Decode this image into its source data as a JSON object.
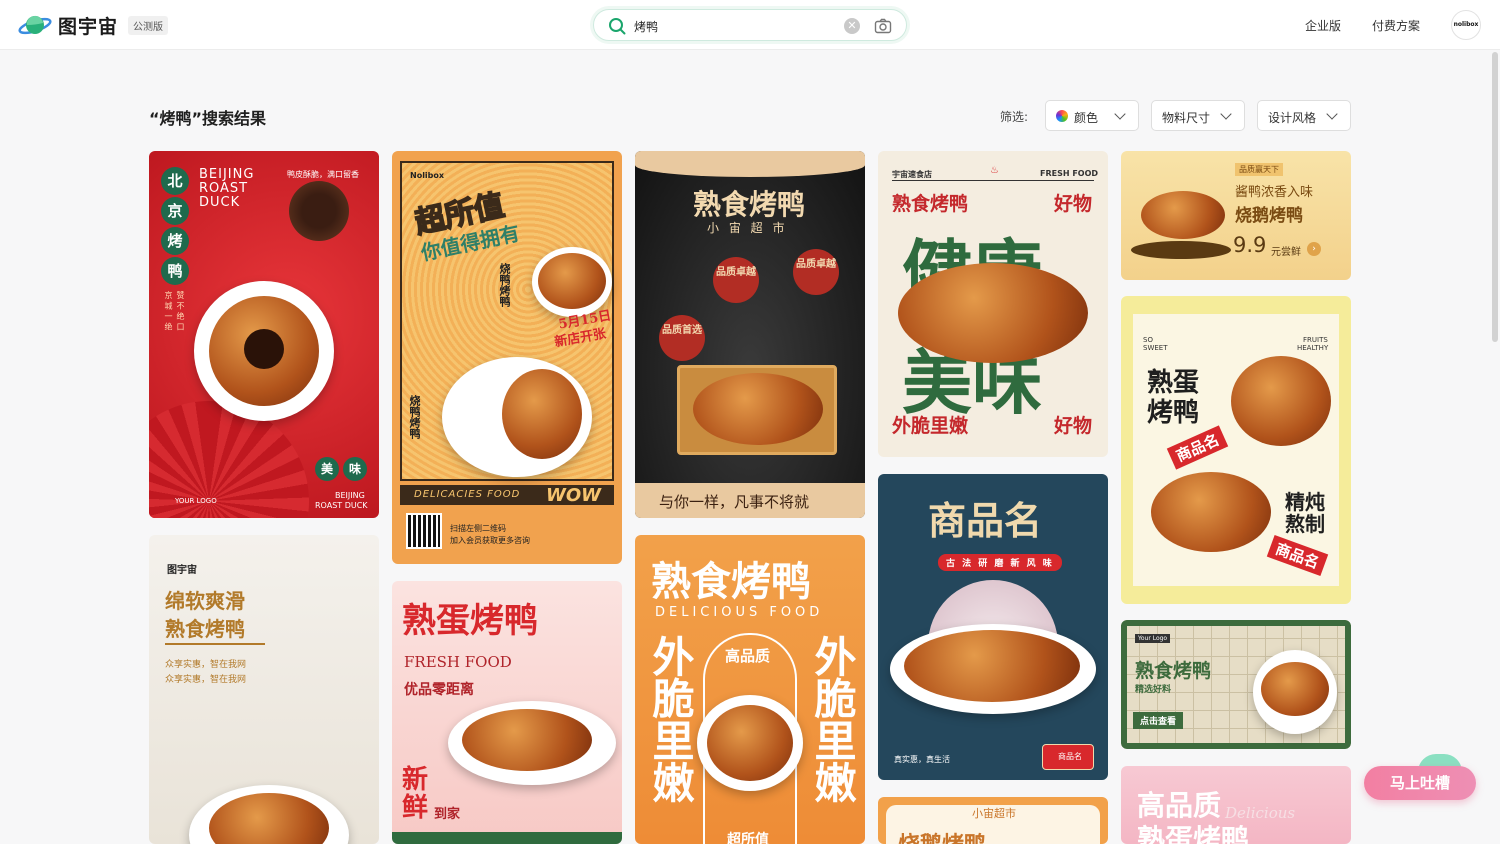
{
  "header": {
    "brand": "图宇宙",
    "badge": "公测版",
    "search": {
      "value": "烤鸭",
      "clear_icon": "clear-icon",
      "camera_icon": "camera-icon"
    },
    "nav": [
      "企业版",
      "付费方案"
    ],
    "avatar_text": "nolibox"
  },
  "results": {
    "title": "“烤鸭”搜索结果",
    "filter_label": "筛选:",
    "filters": [
      "颜色",
      "物料尺寸",
      "设计风格"
    ]
  },
  "cards": {
    "c1": {
      "v1": "北",
      "v2": "京",
      "v3": "烤",
      "v4": "鸭",
      "en1": "BEIJING",
      "en2": "ROAST",
      "en3": "DUCK",
      "tag": "鸭皮酥脆，满口留香",
      "side": "京 城 一 绝",
      "side2": "赞 不 绝 口",
      "b1": "美",
      "b2": "味",
      "logo": "YOUR LOGO",
      "foot1": "BEIJING",
      "foot2": "ROAST DUCK"
    },
    "c2": {
      "brand": "Nolibox",
      "t1": "超所值",
      "t2": "你值得拥有",
      "v1": "烧鸭烤鸭",
      "date1": "5月15日",
      "date2": "新店开张",
      "side": "烧鸭烤鸭",
      "band": "DELICACIES FOOD",
      "wow": "WOW",
      "qr1": "扫描左侧二维码",
      "qr2": "加入会员获取更多咨询"
    },
    "c3": {
      "title": "熟食烤鸭",
      "sub": "小 宙 超 市",
      "b1": "品质卓越",
      "b2": "品质卓越",
      "b3": "品质首选",
      "slogan": "与你一样，凡事不将就"
    },
    "c4": {
      "brand": "宇宙速食店",
      "fresh": "FRESH FOOD",
      "t1": "熟食烤鸭",
      "t2": "好物",
      "big1": "健康",
      "big2": "美味",
      "b1": "外脆里嫩",
      "b2": "好物"
    },
    "c5": {
      "tag": "品质赢天下",
      "t1": "酱鸭浓香入味",
      "t2": "烧鹅烤鸭",
      "price": "9.9",
      "unit": "元尝鲜"
    },
    "c6": {
      "so": "SO",
      "sweet": "SWEET",
      "fruits": "FRUITS",
      "healthy": "HEALTHY",
      "t1": "熟蛋",
      "t2": "烤鸭",
      "n1": "商品名",
      "m1": "精炖",
      "m2": "熬制",
      "n2": "商品名"
    },
    "c7": {
      "brand": "图宇宙",
      "t1": "绵软爽滑",
      "t2": "熟食烤鸭",
      "s1": "众享实惠，智在我网",
      "s2": "众享实惠，智在我网"
    },
    "c8": {
      "t1": "熟蛋烤鸭",
      "en": "FRESH FOOD",
      "sub": "优品零距离",
      "v1": "新",
      "v2": "鲜",
      "v3": "到家"
    },
    "c9": {
      "t1": "熟食烤鸭",
      "en": "DELICIOUS FOOD",
      "left": "外脆里嫩",
      "right": "外脆里嫩",
      "center": "高品质",
      "bottom": "超所值"
    },
    "c10": {
      "t1": "商品名",
      "sub": "古 法 研 磨 新 风 味",
      "foot": "真实惠，真生活",
      "badge": "商品名"
    },
    "c11": {
      "logo": "Your Logo",
      "t1": "熟食烤鸭",
      "sub": "精选好料",
      "btn": "点击查看"
    },
    "c12": {
      "top": "小宙超市",
      "t1": "烧鹅烤鸭"
    },
    "c13": {
      "t1": "高品质",
      "t2": "熟蛋烤鸭",
      "script": "Delicious"
    }
  },
  "feedback": "马上吐槽",
  "colors": {
    "accent": "#1aa56c",
    "red": "#d8282c",
    "orange": "#f0a04b",
    "navy": "#24475c"
  }
}
